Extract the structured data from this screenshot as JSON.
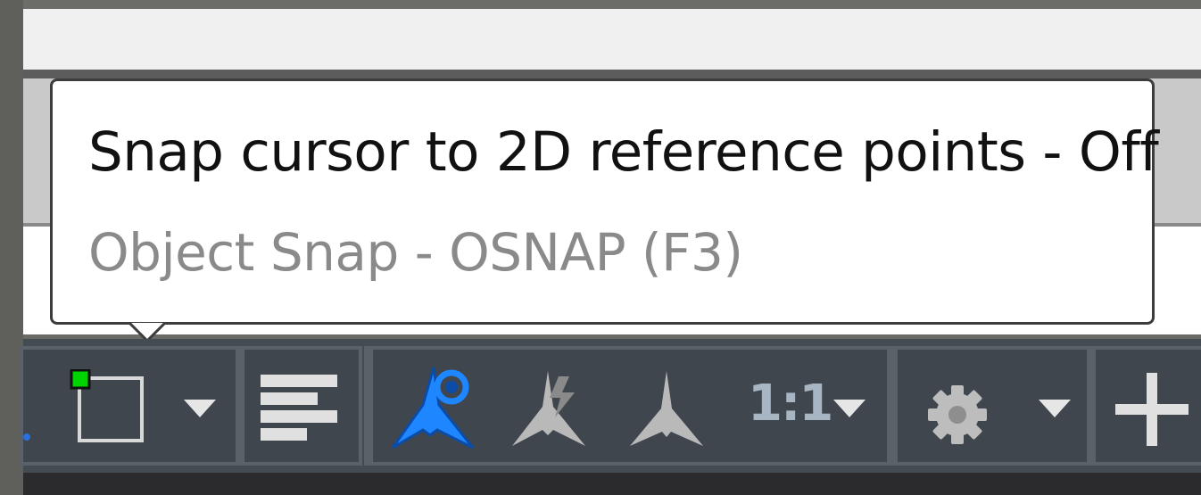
{
  "tooltip": {
    "title": "Snap cursor to 2D reference points - Off",
    "subtitle": "Object Snap - OSNAP (F3)"
  },
  "statusbar": {
    "icons": [
      "object-snap-icon",
      "snap-dropdown-arrow-icon",
      "lineweight-icon",
      "annotation-visibility-icon",
      "auto-scale-icon",
      "annotation-scale-icon",
      "scale-dropdown-arrow-icon",
      "workspace-gear-icon",
      "gear-dropdown-arrow-icon",
      "add-icon"
    ],
    "annotation_scale": "1:1",
    "colors": {
      "background": "#454b52",
      "active_blue": "#1e86ff",
      "inactive_gray": "#b7b7b7",
      "snap_green": "#00d400"
    }
  }
}
